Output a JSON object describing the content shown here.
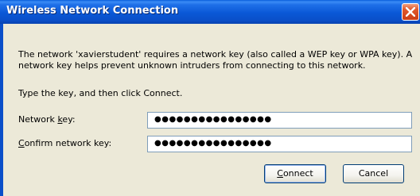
{
  "dialog": {
    "title": "Wireless Network Connection",
    "message_line1": "The network 'xavierstudent' requires a network key (also called a WEP key or WPA key). A",
    "message_line2": "network key helps prevent unknown intruders from connecting to this network.",
    "instruction": "Type the key, and then click Connect."
  },
  "fields": {
    "network_key": {
      "label_before": "Network ",
      "label_mnemonic": "k",
      "label_after": "ey:",
      "value": "●●●●●●●●●●●●●●●●"
    },
    "confirm_key": {
      "label_before": "",
      "label_mnemonic": "C",
      "label_after": "onfirm network key:",
      "value": "●●●●●●●●●●●●●●●●"
    }
  },
  "buttons": {
    "connect": {
      "mnemonic": "C",
      "rest": "onnect"
    },
    "cancel": {
      "label": "Cancel"
    }
  },
  "colors": {
    "titlebar": "#0a58d6",
    "dialog_bg": "#ece9d8",
    "close_button": "#e0582c",
    "field_border": "#7f9db9"
  },
  "icons": {
    "close": "close-x-icon"
  }
}
